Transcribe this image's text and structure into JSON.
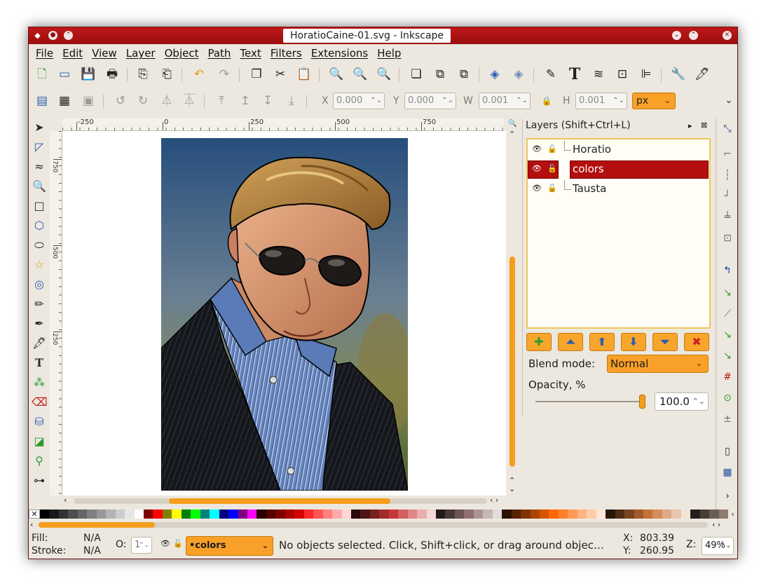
{
  "window": {
    "title": "HoratioCaine-01.svg - Inkscape"
  },
  "menu": {
    "items": [
      "File",
      "Edit",
      "View",
      "Layer",
      "Object",
      "Path",
      "Text",
      "Filters",
      "Extensions",
      "Help"
    ]
  },
  "toolbar2": {
    "x_label": "X",
    "x_value": "0.000",
    "y_label": "Y",
    "y_value": "0.000",
    "w_label": "W",
    "w_value": "0.001",
    "h_label": "H",
    "h_value": "0.001",
    "unit": "px"
  },
  "ruler": {
    "labels": [
      "-250",
      "0",
      "250",
      "500",
      "750"
    ],
    "v_labels": [
      "750",
      "500",
      "250"
    ]
  },
  "layers": {
    "title": "Layers (Shift+Ctrl+L)",
    "items": [
      {
        "name": "Horatio"
      },
      {
        "name": "colors"
      },
      {
        "name": "Tausta"
      }
    ],
    "blend_label": "Blend mode:",
    "blend_value": "Normal",
    "opacity_label": "Opacity, %",
    "opacity_value": "100.0"
  },
  "status": {
    "fill_label": "Fill:",
    "fill_value": "N/A",
    "stroke_label": "Stroke:",
    "stroke_value": "N/A",
    "o_label": "O:",
    "o_value": "1",
    "current_layer": "•colors",
    "message": "No objects selected. Click, Shift+click, or drag around objec…",
    "x_label": "X:",
    "x_value": "803.39",
    "y_label": "Y:",
    "y_value": "260.95",
    "z_label": "Z:",
    "zoom": "49%"
  },
  "colors": {
    "titlebar": "#b31414",
    "accent": "#f9a028",
    "selection": "#b30f0f"
  }
}
